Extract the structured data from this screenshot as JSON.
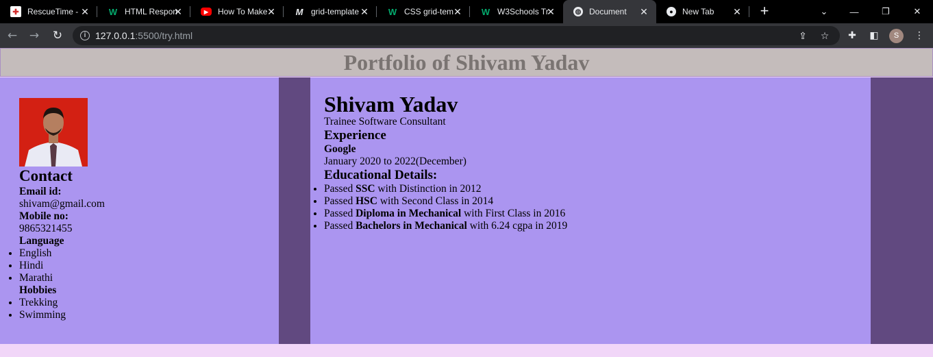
{
  "browser": {
    "tabs": [
      {
        "title": "RescueTime -",
        "icon": "rescuetime-icon"
      },
      {
        "title": "HTML Respon",
        "icon": "w3schools-icon"
      },
      {
        "title": "How To Make",
        "icon": "youtube-icon"
      },
      {
        "title": "grid-template",
        "icon": "mdn-icon"
      },
      {
        "title": "CSS grid-tem",
        "icon": "w3schools-icon"
      },
      {
        "title": "W3Schools Tr",
        "icon": "w3schools-icon"
      },
      {
        "title": "Document",
        "icon": "globe-icon",
        "active": true
      },
      {
        "title": "New Tab",
        "icon": "chrome-icon"
      }
    ],
    "url_host": "127.0.0.1",
    "url_path": ":5500/try.html",
    "profile_initial": "S"
  },
  "page": {
    "header_title": "Portfolio of Shivam Yadav",
    "contact": {
      "heading": "Contact",
      "email_label": "Email id:",
      "email": "shivam@gmail.com",
      "mobile_label": "Mobile no:",
      "mobile": "9865321455",
      "language_label": "Language",
      "languages": [
        "English",
        "Hindi",
        "Marathi"
      ],
      "hobbies_label": "Hobbies",
      "hobbies": [
        "Trekking",
        "Swimming"
      ]
    },
    "main": {
      "name": "Shivam Yadav",
      "role": "Trainee Software Consultant",
      "experience_heading": "Experience",
      "company": "Google",
      "duration": "January 2020 to 2022(December)",
      "education_heading": "Educational Details:",
      "education": [
        {
          "pre": "Passed ",
          "bold": "SSC",
          "post": " with Distinction in 2012"
        },
        {
          "pre": "Passed ",
          "bold": "HSC",
          "post": " with Second Class in 2014"
        },
        {
          "pre": "Passed ",
          "bold": "Diploma in Mechanical",
          "post": " with First Class in 2016"
        },
        {
          "pre": "Passed ",
          "bold": "Bachelors in Mechanical",
          "post": " with 6.24 cgpa in 2019"
        }
      ]
    }
  },
  "colors": {
    "panel": "#ab95f0",
    "gap": "#614980",
    "header_bg": "#c4bcbb",
    "header_text": "#7a7472",
    "page_bg": "#f1d6f8"
  }
}
